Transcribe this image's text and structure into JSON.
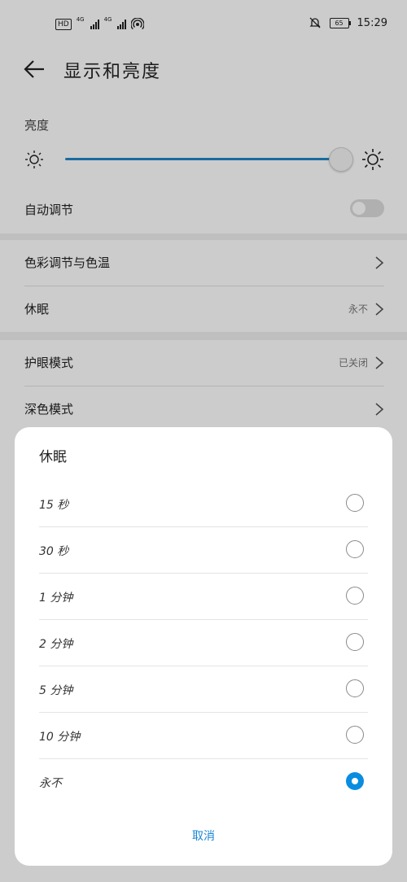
{
  "status_bar": {
    "hd_label": "HD",
    "signal_label_1": "4G",
    "signal_label_2": "4G",
    "battery": "65",
    "time": "15:29"
  },
  "header": {
    "title": "显示和亮度"
  },
  "brightness": {
    "label": "亮度",
    "level": 0.95
  },
  "auto_adjust": {
    "label": "自动调节",
    "enabled": false
  },
  "rows": {
    "color": {
      "label": "色彩调节与色温"
    },
    "sleep": {
      "label": "休眠",
      "value": "永不"
    },
    "eye": {
      "label": "护眼模式",
      "value": "已关闭"
    },
    "dark": {
      "label": "深色模式"
    }
  },
  "dialog": {
    "title": "休眠",
    "options": [
      {
        "label": "15 秒",
        "selected": false
      },
      {
        "label": "30 秒",
        "selected": false
      },
      {
        "label": "1 分钟",
        "selected": false
      },
      {
        "label": "2 分钟",
        "selected": false
      },
      {
        "label": "5 分钟",
        "selected": false
      },
      {
        "label": "10 分钟",
        "selected": false
      },
      {
        "label": "永不",
        "selected": true
      }
    ],
    "cancel_label": "取消"
  },
  "colors": {
    "accent": "#0a8de0",
    "slider": "#1e88c9"
  }
}
